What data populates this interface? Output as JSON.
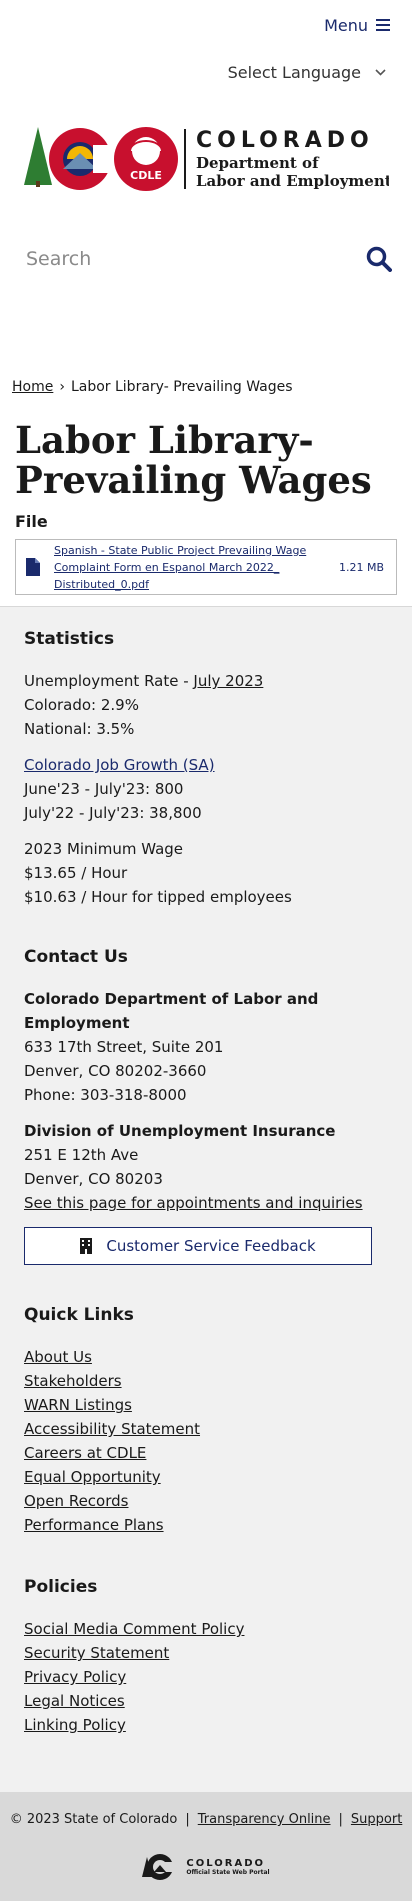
{
  "header": {
    "menu_label": "Menu",
    "language_label": "Select Language",
    "logo_title": "COLORADO",
    "logo_dept_line1": "Department of",
    "logo_dept_line2": "Labor and Employment",
    "logo_badge": "CDLE",
    "search_placeholder": "Search"
  },
  "breadcrumb": {
    "home": "Home",
    "separator": "›",
    "current": "Labor Library- Prevailing Wages"
  },
  "page": {
    "title": "Labor Library- Prevailing Wages",
    "file_label": "File",
    "file_name": "Spanish - State Public Project Prevailing Wage Complaint Form en Espanol March 2022_ Distributed_0.pdf",
    "file_size": "1.21 MB"
  },
  "statistics": {
    "heading": "Statistics",
    "unemployment_prefix": "Unemployment Rate - ",
    "unemployment_link": "July 2023",
    "colorado": "Colorado: 2.9%",
    "national": "National: 3.5%",
    "job_growth_link": "Colorado Job Growth (SA)",
    "job_growth_1": "June'23 - July'23: 800",
    "job_growth_2": "July'22 - July'23: 38,800",
    "min_wage_title": "2023 Minimum Wage",
    "min_wage_1": "$13.65 / Hour",
    "min_wage_2": "$10.63 / Hour for tipped employees"
  },
  "contact": {
    "heading": "Contact Us",
    "org1_line1": "Colorado Department of Labor and",
    "org1_line2": "Employment",
    "org1_address1": "633 17th Street, Suite 201",
    "org1_address2": "Denver, CO  80202-3660",
    "org1_phone": "Phone: 303-318-8000",
    "org2_name": "Division of Unemployment Insurance",
    "org2_address1": "251 E 12th Ave",
    "org2_address2": "Denver, CO  80203",
    "org2_link": "See this page for appointments and inquiries",
    "feedback_button": "Customer Service Feedback"
  },
  "quick_links": {
    "heading": "Quick Links",
    "items": [
      "About Us",
      "Stakeholders",
      "WARN Listings",
      "Accessibility Statement",
      "Careers at CDLE",
      "Equal Opportunity",
      "Open Records",
      "Performance Plans"
    ]
  },
  "policies": {
    "heading": "Policies",
    "items": [
      "Social Media Comment Policy",
      "Security Statement",
      "Privacy Policy",
      "Legal Notices",
      "Linking Policy"
    ]
  },
  "footer": {
    "copyright": "© 2023 State of Colorado",
    "sep": "|",
    "transparency": "Transparency Online",
    "support": "Support",
    "portal_title": "COLORADO",
    "portal_sub": "Official State Web Portal"
  },
  "colors": {
    "accent_navy": "#1a2a6c",
    "footer_bg": "#f1f1f1",
    "bottom_bar_bg": "#d9d9d9"
  }
}
